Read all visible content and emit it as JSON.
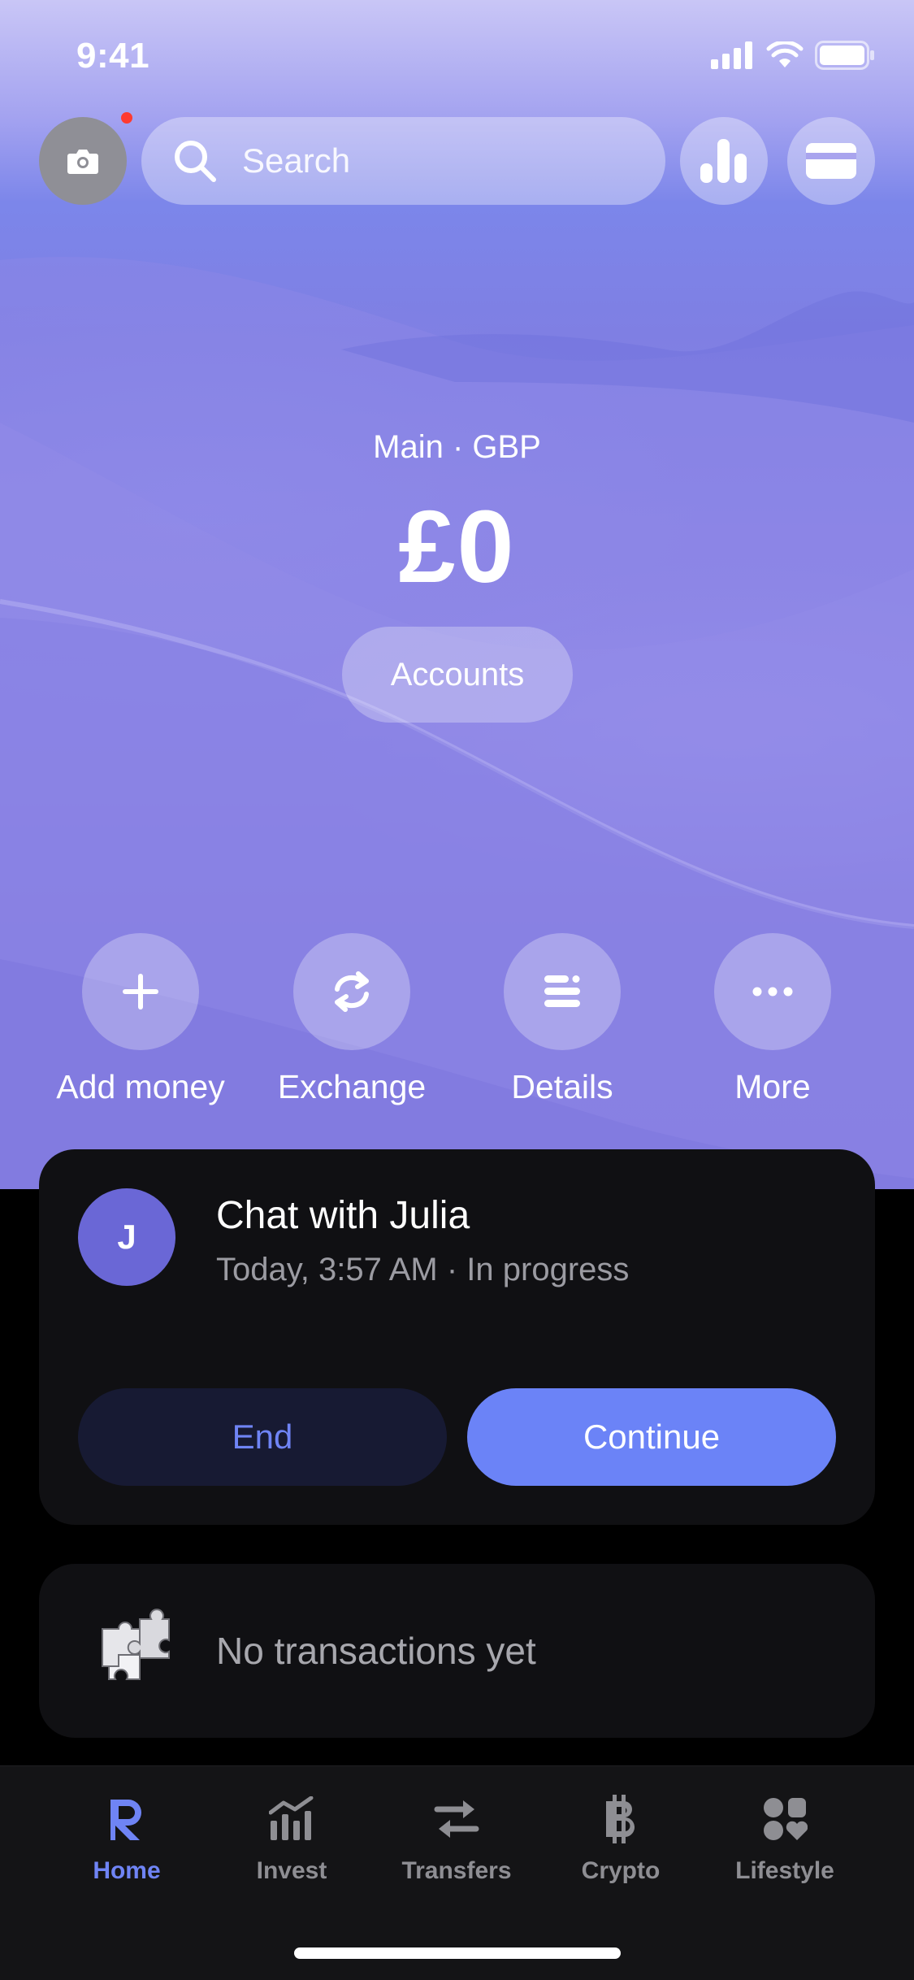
{
  "status_bar": {
    "time": "9:41"
  },
  "search": {
    "placeholder": "Search"
  },
  "balance": {
    "account_label": "Main · GBP",
    "amount": "£0",
    "accounts_button": "Accounts"
  },
  "actions": [
    {
      "label": "Add money",
      "icon": "plus-icon"
    },
    {
      "label": "Exchange",
      "icon": "exchange-icon"
    },
    {
      "label": "Details",
      "icon": "details-icon"
    },
    {
      "label": "More",
      "icon": "more-icon"
    }
  ],
  "chat": {
    "avatar_initial": "J",
    "title": "Chat with Julia",
    "subtitle": "Today, 3:57 AM · In progress",
    "end_label": "End",
    "continue_label": "Continue"
  },
  "transactions": {
    "empty_text": "No transactions yet"
  },
  "tabs": [
    {
      "label": "Home",
      "icon": "revolut-logo-icon",
      "active": true
    },
    {
      "label": "Invest",
      "icon": "invest-chart-icon",
      "active": false
    },
    {
      "label": "Transfers",
      "icon": "transfers-icon",
      "active": false
    },
    {
      "label": "Crypto",
      "icon": "bitcoin-icon",
      "active": false
    },
    {
      "label": "Lifestyle",
      "icon": "lifestyle-icon",
      "active": false
    }
  ],
  "colors": {
    "accent": "#6b83f7",
    "accent_text": "#6f84f5",
    "card_bg": "#101013",
    "notification": "#ff3b30"
  }
}
